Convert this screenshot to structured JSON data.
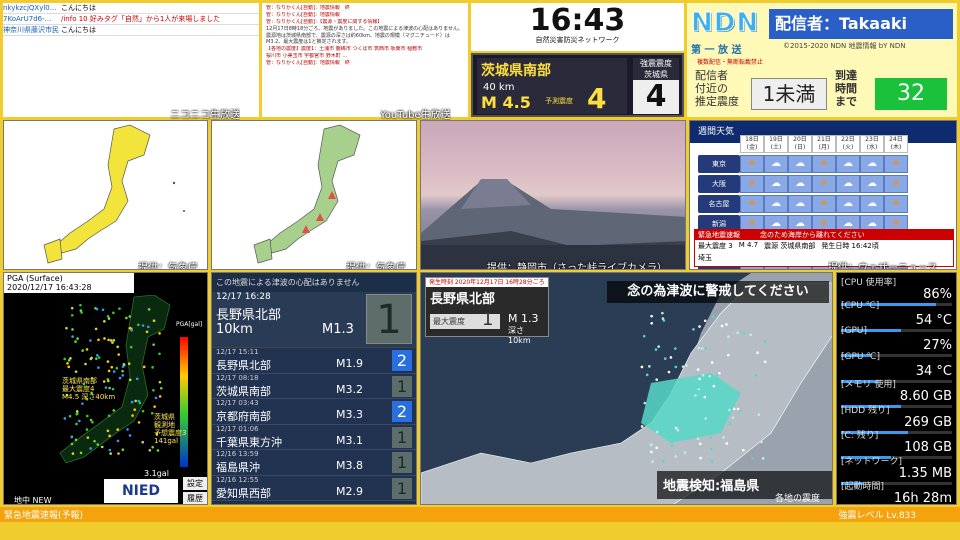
{
  "chat": [
    {
      "user": "nkykzcjQXyl0...",
      "msg": "こんにちは",
      "red": false
    },
    {
      "user": "7KoArU7d6-...",
      "msg": "/info 10 好みタグ「自然」から1人が来場しました",
      "red": true
    },
    {
      "user": "神奈川県藤沢市民",
      "msg": "こんにちは",
      "red": false
    }
  ],
  "nico_label": "ニコニコ生放送",
  "youtube": {
    "lines": [
      "管：なりかくん[自動]：地震情報　終",
      "管：なりかくん[自動]：地震情報",
      "管：なりかくん[自動]：【震源・震度に関する情報】"
    ],
    "body": "12月17日8時18分ごろ、地震がありました。この地震による津波の心配はありません。震源地は茨城県南部で、震源の深さは約60km、地震の規模（マグニチュード）はM3.2、最大震度は1と推定されます。",
    "lines2": [
      "【各地の震度】震度1：土浦市 鹿嶋市 つくば市 筑西市 坂東市 稲敷市",
      "桜川市 小美玉市 宇都宮市 野木町 ...",
      "管：なりかくん[自動]：地震情報　終"
    ],
    "label": "YouTube生放送"
  },
  "clock": {
    "time": "16:43",
    "sub": "自然災害防災ネットワーク"
  },
  "eew": {
    "area": "茨城県南部",
    "depth": "40 km",
    "mag": "M 4.5",
    "pi_label": "予測震度",
    "pi": "4",
    "side_a": "強震震度",
    "side_b": "茨城県",
    "side_int": "4"
  },
  "ndn": {
    "logo": "NDN",
    "header": "配信者：Takaaki",
    "sub": "第 一 放 送",
    "copy": "©2015-2020 NDN 地震情報 bY NDN",
    "copy2": "複数配信・無断転載禁止",
    "lbl1": "配信者\n付近の\n推定震度",
    "int": "1未満",
    "lbl2": "到達\n時間\nまで",
    "arr": "32"
  },
  "credits": {
    "map1": "提供：気象庁",
    "map2": "提供：気象庁",
    "cam": "提供：静岡市（さった峠ライブカメラ）",
    "weather": "提供：ウェザーニュース"
  },
  "weather": {
    "title": "週間天気",
    "dates": [
      "18日(金)",
      "19日(土)",
      "20日(日)",
      "21日(月)",
      "22日(火)",
      "23日(水)",
      "24日(木)"
    ],
    "cities": [
      "東京",
      "大阪",
      "名古屋",
      "新潟",
      "金沢",
      "福岡"
    ],
    "alert_title": "緊急地震速報",
    "alert_msg": "念のため海岸から離れてください",
    "alert_max": "最大震度 3",
    "alert_mag": "M 4.7",
    "alert_area": "震源 茨城県南部",
    "alert_time": "発生日時 16:42頃",
    "alert_pref": "埼玉"
  },
  "pga": {
    "title": "PGA (Surface)",
    "time": "2020/12/17 16:43:28",
    "legend": "PGA[gal]",
    "loc1": "茨城県南部\n最大震度4\nM4.5 深さ40km",
    "loc2": "茨城県\n観測地\n予想震度3\n141gal",
    "gal": "3.1gal",
    "src": "地中 NEW",
    "logo": "NIED",
    "b1": "設定",
    "b2": "履歴"
  },
  "quake": {
    "header": "この地震による津波の心配はありません",
    "main": {
      "date": "12/17 16:28",
      "area": "長野県北部",
      "depth": "10km",
      "mag": "M1.3",
      "si": "1"
    },
    "rows": [
      {
        "date": "12/17 15:11",
        "area": "長野県北部",
        "mag": "M1.9",
        "si": "2"
      },
      {
        "date": "12/17 08:18",
        "area": "茨城県南部",
        "mag": "M3.2",
        "si": "1"
      },
      {
        "date": "12/17 03:43",
        "area": "京都府南部",
        "mag": "M3.3",
        "si": "2"
      },
      {
        "date": "12/17 01:06",
        "area": "千葉県東方沖",
        "mag": "M3.1",
        "si": "1"
      },
      {
        "date": "12/16 13:59",
        "area": "福島県沖",
        "mag": "M3.8",
        "si": "1"
      },
      {
        "date": "12/16 12:55",
        "area": "愛知県西部",
        "mag": "M2.9",
        "si": "1"
      }
    ]
  },
  "bigmap": {
    "time": "発生時刻 2020年12月17日 16時28分ごろ",
    "area": "長野県北部",
    "si_label": "最大震度",
    "si": "1",
    "mag": "M 1.3",
    "depth": "深さ 10km",
    "warn": "念の為津波に警戒してください",
    "detect": "地震検知:福島県",
    "detect2": "各地の震度"
  },
  "sys": [
    {
      "label": "[CPU 使用率]",
      "value": "86%",
      "bar": 0.86
    },
    {
      "label": "[CPU ℃]",
      "value": "54 °C",
      "bar": 0.54
    },
    {
      "label": "[GPU]",
      "value": "27%",
      "bar": 0.27
    },
    {
      "label": "[GPU ℃]",
      "value": "34 °C",
      "bar": 0.34
    },
    {
      "label": "[メモリ 使用]",
      "value": "8.60 GB",
      "bar": 0.54
    },
    {
      "label": "[HDD 残り]",
      "value": "269 GB",
      "bar": 0.6
    },
    {
      "label": "[C: 残り]",
      "value": "108 GB",
      "bar": 0.45
    },
    {
      "label": "[ネットワーク]",
      "value": "1.35 MB",
      "bar": 0.2
    },
    {
      "label": "[起動時間]",
      "value": "16h 28m",
      "bar": 0.7
    }
  ],
  "bottom": {
    "left": "緊急地震速報(予報)",
    "right": "強震レベル Lv.833"
  }
}
